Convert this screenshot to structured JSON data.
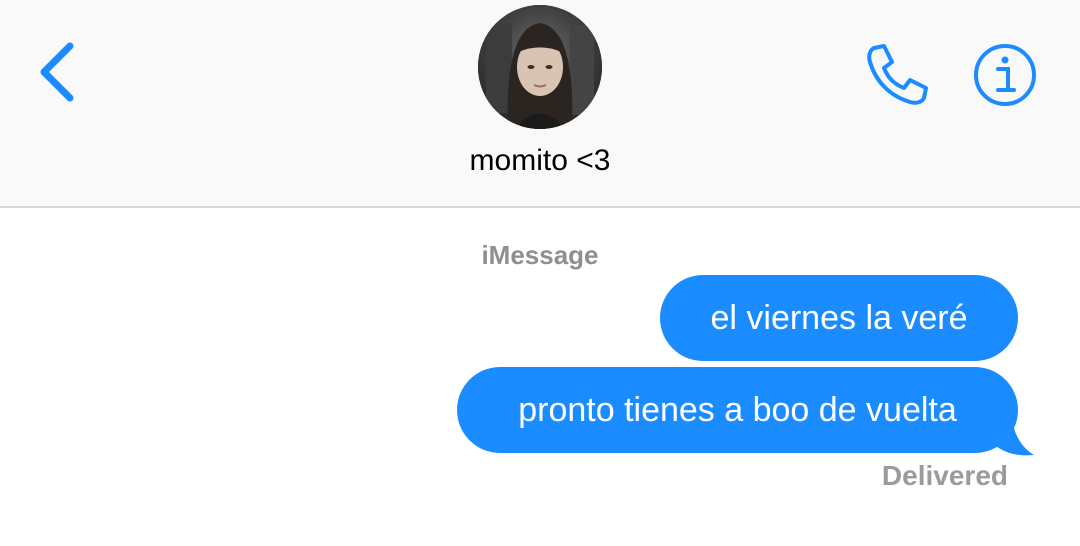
{
  "header": {
    "contact_name": "momito <3",
    "icons": {
      "back": "chevron-left-icon",
      "phone": "phone-icon",
      "info": "info-icon"
    },
    "accent_color": "#1a8cff"
  },
  "conversation": {
    "service_label": "iMessage",
    "messages": [
      {
        "text": "el viernes la veré",
        "direction": "outgoing"
      },
      {
        "text": "pronto tienes a boo de vuelta",
        "direction": "outgoing"
      }
    ],
    "status": "Delivered",
    "bubble_color": "#1a8cff"
  }
}
